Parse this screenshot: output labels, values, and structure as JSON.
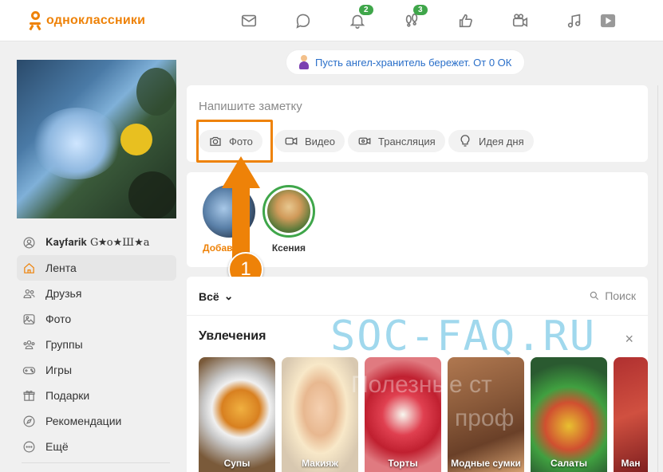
{
  "brand": {
    "name": "одноклассники",
    "color": "#ee8208"
  },
  "header": {
    "icons": [
      {
        "name": "messages-icon",
        "badge": ""
      },
      {
        "name": "discussions-icon",
        "badge": ""
      },
      {
        "name": "notifications-icon",
        "badge": "2"
      },
      {
        "name": "guests-icon",
        "badge": "3"
      },
      {
        "name": "marks-icon",
        "badge": ""
      },
      {
        "name": "video-icon",
        "badge": ""
      },
      {
        "name": "music-icon",
        "badge": ""
      },
      {
        "name": "games-play-icon",
        "badge": ""
      }
    ]
  },
  "sidebar": {
    "username": "𝐊𝐚𝐲𝐟𝐚𝐫𝐢𝐤 G★о★Ш★а",
    "items": [
      {
        "label": "Лента",
        "icon": "home-icon"
      },
      {
        "label": "Друзья",
        "icon": "friends-icon"
      },
      {
        "label": "Фото",
        "icon": "photo-icon"
      },
      {
        "label": "Группы",
        "icon": "groups-icon"
      },
      {
        "label": "Игры",
        "icon": "games-icon"
      },
      {
        "label": "Подарки",
        "icon": "gift-icon"
      },
      {
        "label": "Рекомендации",
        "icon": "compass-icon"
      },
      {
        "label": "Ещё",
        "icon": "more-icon"
      }
    ]
  },
  "guardian": {
    "text": "Пусть ангел-хранитель бережет. От 0 ОК"
  },
  "post": {
    "placeholder": "Напишите заметку",
    "actions": [
      "Фото",
      "Видео",
      "Трансляция",
      "Идея дня"
    ]
  },
  "stories": [
    {
      "label": "Добави"
    },
    {
      "label": "Ксения"
    }
  ],
  "annotation": {
    "number": "1"
  },
  "feed": {
    "filter": "Всё",
    "search": "Поиск",
    "hobbies_title": "Увлечения",
    "close": "×",
    "tiles": [
      "Супы",
      "Макияж",
      "Торты",
      "Модные сумки",
      "Салаты",
      "Ман"
    ]
  },
  "watermark": {
    "text": "SOC-FAQ.RU",
    "line1": "Полезные ст",
    "line2": "проф"
  }
}
